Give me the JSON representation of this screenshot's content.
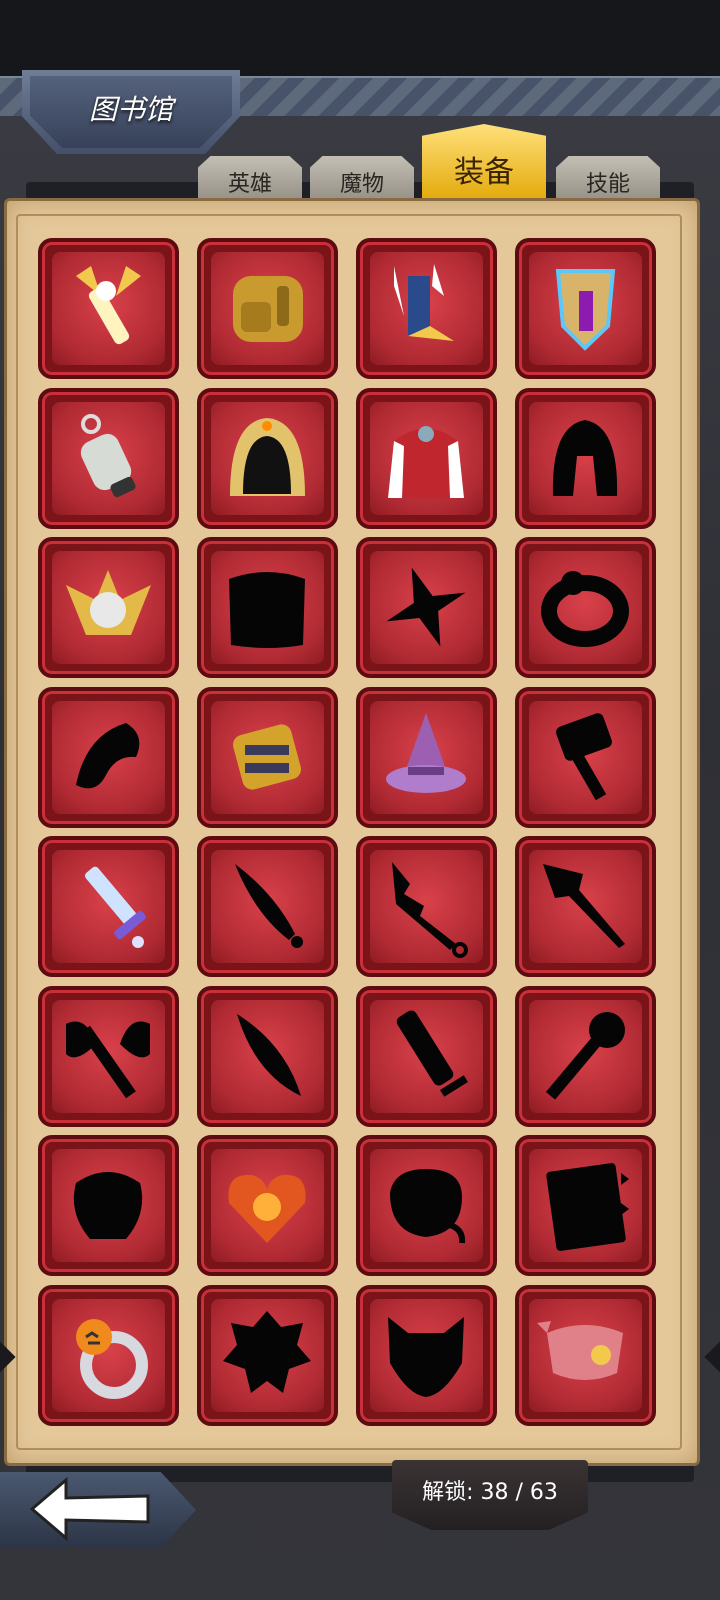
{
  "header": {
    "title": "图书馆"
  },
  "tabs": [
    {
      "label": "英雄",
      "active": false
    },
    {
      "label": "魔物",
      "active": false
    },
    {
      "label": "装备",
      "active": true
    },
    {
      "label": "技能",
      "active": false
    }
  ],
  "items": [
    {
      "name": "winged-scepter-icon",
      "unlocked": true
    },
    {
      "name": "backpack-icon",
      "unlocked": true
    },
    {
      "name": "winged-boots-icon",
      "unlocked": true
    },
    {
      "name": "lightning-shield-icon",
      "unlocked": true
    },
    {
      "name": "bell-icon",
      "unlocked": true
    },
    {
      "name": "hood-icon",
      "unlocked": true
    },
    {
      "name": "fur-cape-icon",
      "unlocked": true
    },
    {
      "name": "helmet-icon",
      "unlocked": false
    },
    {
      "name": "golden-helm-icon",
      "unlocked": true
    },
    {
      "name": "armor-icon",
      "unlocked": false
    },
    {
      "name": "shuriken-icon",
      "unlocked": false
    },
    {
      "name": "ring-icon",
      "unlocked": false
    },
    {
      "name": "claw-icon",
      "unlocked": false
    },
    {
      "name": "golden-gauntlet-icon",
      "unlocked": true
    },
    {
      "name": "witch-hat-icon",
      "unlocked": true
    },
    {
      "name": "hammer-icon",
      "unlocked": false
    },
    {
      "name": "crystal-sword-icon",
      "unlocked": true
    },
    {
      "name": "dagger-icon",
      "unlocked": false
    },
    {
      "name": "jagged-blade-icon",
      "unlocked": false
    },
    {
      "name": "spear-icon",
      "unlocked": false
    },
    {
      "name": "battle-axe-icon",
      "unlocked": false
    },
    {
      "name": "feather-blade-icon",
      "unlocked": false
    },
    {
      "name": "great-sword-icon",
      "unlocked": false
    },
    {
      "name": "mace-icon",
      "unlocked": false
    },
    {
      "name": "shadow-beast-icon",
      "unlocked": false
    },
    {
      "name": "burning-heart-icon",
      "unlocked": true
    },
    {
      "name": "bag-icon",
      "unlocked": false
    },
    {
      "name": "spiked-book-icon",
      "unlocked": false
    },
    {
      "name": "pumpkin-ring-icon",
      "unlocked": true
    },
    {
      "name": "emblem-icon",
      "unlocked": false
    },
    {
      "name": "mask-icon",
      "unlocked": false
    },
    {
      "name": "bandana-icon",
      "unlocked": true
    }
  ],
  "footer": {
    "unlock_text": "解锁: 38 / 63"
  },
  "colors": {
    "slot_red": "#b02a33",
    "tab_active": "#f0c030",
    "panel": "#e4c89a"
  }
}
